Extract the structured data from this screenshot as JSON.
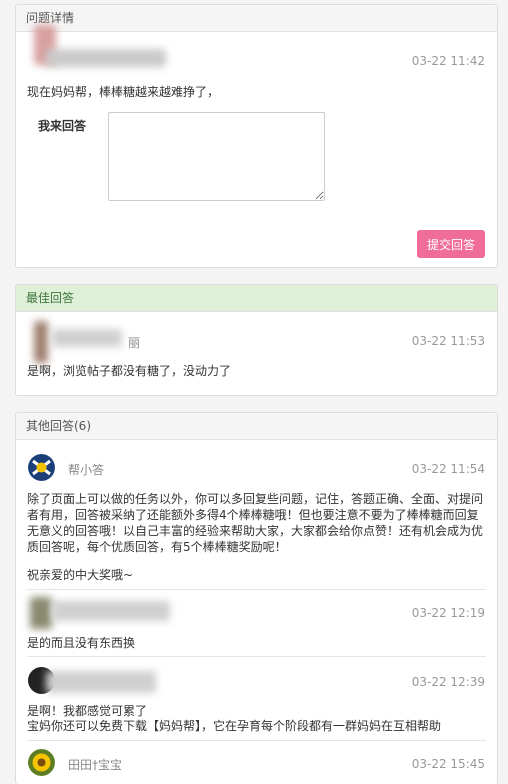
{
  "question": {
    "header": "问题详情",
    "time": "03-22 11:42",
    "text": "现在妈妈帮，棒棒糖越来越难挣了，",
    "answer_label": "我来回答",
    "answer_value": "",
    "submit_label": "提交回答"
  },
  "best": {
    "header": "最佳回答",
    "name": "丽",
    "time": "03-22 11:53",
    "text": "是啊，浏览帖子都没有糖了，没动力了"
  },
  "others": {
    "header": "其他回答(6)",
    "answers": [
      {
        "name": "帮小答",
        "time": "03-22 11:54",
        "text": "除了页面上可以做的任务以外，你可以多回复些问题，记住，答题正确、全面、对提问者有用，回答被采纳了还能额外多得4个棒棒糖哦！但也要注意不要为了棒棒糖而回复无意义的回答哦！以自己丰富的经验来帮助大家，大家都会给你点赞！还有机会成为优质回答呢，每个优质回答，有5个棒棒糖奖励呢！",
        "text2": "祝亲爱的中大奖哦~"
      },
      {
        "name": "",
        "time": "03-22 12:19",
        "text": "是的而且没有东西换"
      },
      {
        "name": "",
        "time": "03-22 12:39",
        "text": "是啊！我都感觉可累了",
        "text2": "宝妈你还可以免费下载【妈妈帮】，它在孕育每个阶段都有一群妈妈在互相帮助"
      },
      {
        "name": "田田†宝宝",
        "time": "03-22 15:45"
      }
    ]
  },
  "colors": {
    "accent": "#f06d9a",
    "best_header_bg": "#dff0d8",
    "best_header_text": "#3c763d"
  }
}
